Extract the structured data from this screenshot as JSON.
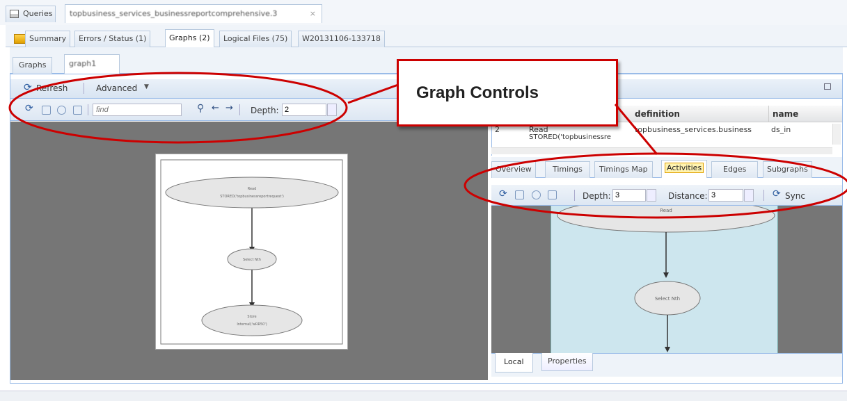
{
  "top_tabs": {
    "queries": "Queries",
    "workunit": "topbusiness_services_businessreportcomprehensive.3"
  },
  "wu_tabs": [
    "Summary",
    "Errors / Status (1)",
    "Graphs (2)",
    "Logical Files (75)",
    "W20131106-133718"
  ],
  "graph_tabs": [
    "Graphs",
    "graph1"
  ],
  "toolbar": {
    "refresh": "Refresh",
    "advanced": "Advanced"
  },
  "find": {
    "placeholder": "find"
  },
  "depth": {
    "label": "Depth:",
    "value": "2"
  },
  "callout": "Graph Controls",
  "main_graph": {
    "node1_line1": "Read",
    "node1_line2": "STORED('topbusinessreportrequest')",
    "node2": "Select Nth",
    "node3_line1": "Store",
    "node3_line2": "Internal('wRR50')"
  },
  "table": {
    "headers": [
      "definition",
      "name"
    ],
    "row": {
      "id": "2",
      "label": "Read",
      "label2": "STORED('topbusinessre",
      "definition": "topbusiness_services.business",
      "name": "ds_in"
    }
  },
  "detail_tabs": [
    "Overview",
    "Timings",
    "Timings Map",
    "Activities",
    "Edges",
    "Subgraphs"
  ],
  "sub_toolbar": {
    "depth_label": "Depth:",
    "depth_value": "3",
    "distance_label": "Distance:",
    "distance_value": "3",
    "sync": "Sync"
  },
  "local_graph": {
    "node1": "Read",
    "node2": "Select Nth"
  },
  "bottom_tabs": [
    "Local",
    "Properties"
  ],
  "colors": {
    "accent": "#99bbe8",
    "callout": "#cc0000",
    "canvas": "#7a7a7a",
    "local_bg": "#cde6ee"
  }
}
